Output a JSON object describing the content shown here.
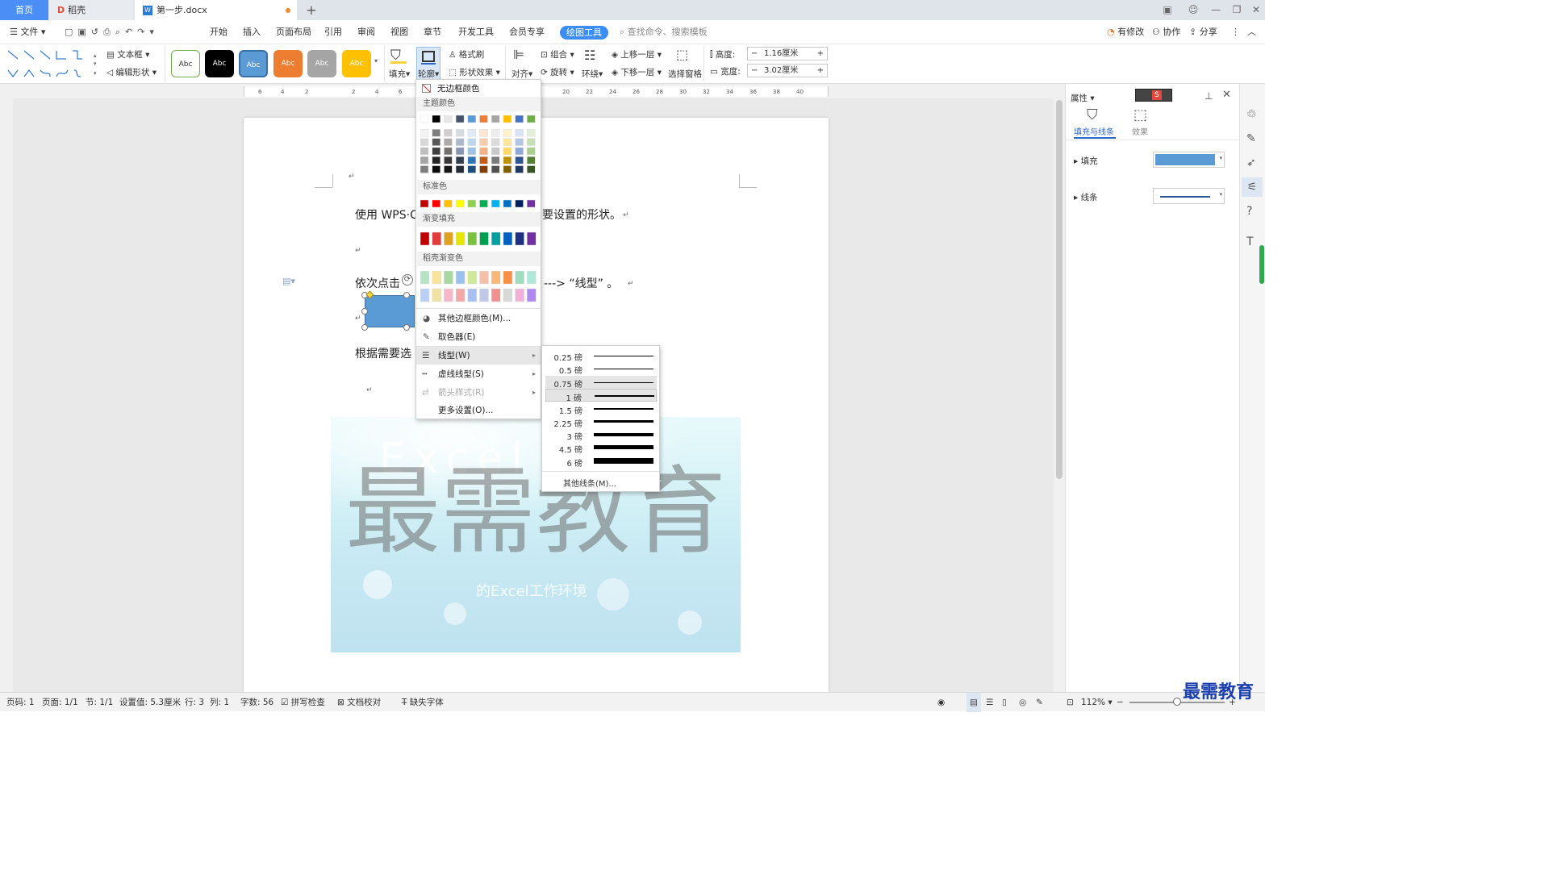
{
  "tabs": {
    "home": "首页",
    "daoke": "稻壳",
    "doc": "第一步.docx"
  },
  "menubar": {
    "file": "文件",
    "items": [
      "开始",
      "插入",
      "页面布局",
      "引用",
      "审阅",
      "视图",
      "章节",
      "开发工具",
      "会员专享"
    ],
    "active": "绘图工具",
    "search": "查找命令、搜索模板",
    "modify": "有修改",
    "collab": "协作",
    "share": "分享"
  },
  "ribbon": {
    "textbox": "文本框",
    "edit_shape": "编辑形状",
    "style_label": "Abc",
    "fill": "填充",
    "outline": "轮廓",
    "format_brush": "格式刷",
    "shape_effect": "形状效果",
    "align": "对齐",
    "group": "组合",
    "rotate": "旋转",
    "wrap": "环绕",
    "up": "上移一层",
    "down": "下移一层",
    "select_pane": "选择窗格",
    "height_label": "高度:",
    "height_value": "1.16厘米",
    "width_label": "宽度:",
    "width_value": "3.02厘米"
  },
  "doc": {
    "line1a": "使用 WPS·C",
    "line1b": "要设置的形状。",
    "line2a": "依次点击",
    "line2b": "--->  “线型”  。",
    "line3": "根据需要选",
    "watermark_big": "最需教育",
    "watermark_sub": "的Excel工作环境",
    "watermark_faint": "Excel"
  },
  "outline_menu": {
    "no_border": "无边框颜色",
    "theme": "主题颜色",
    "standard": "标准色",
    "gradient": "渐变填充",
    "daoke_gradient": "稻壳渐变色",
    "other_color": "其他边框颜色(M)...",
    "picker": "取色器(E)",
    "line_type": "线型(W)",
    "dash_type": "虚线线型(S)",
    "arrow_style": "箭头样式(R)",
    "more": "更多设置(O)..."
  },
  "line_widths": [
    "0.25 磅",
    "0.5 磅",
    "0.75 磅",
    "1 磅",
    "1.5 磅",
    "2.25 磅",
    "3 磅",
    "4.5 磅",
    "6 磅"
  ],
  "line_widths_more": "其他线条(M)...",
  "rpanel": {
    "title": "属性",
    "tab1": "填充与线条",
    "tab2": "效果",
    "fill": "填充",
    "line": "线条",
    "fill_color": "#5b9bd5"
  },
  "status": {
    "pagenum": "页码: 1",
    "page": "页面: 1/1",
    "section": "节: 1/1",
    "setting": "设置值: 5.3厘米",
    "row": "行: 3",
    "col": "列: 1",
    "words": "字数: 56",
    "spell": "拼写检查",
    "proof": "文档校对",
    "font": "缺失字体",
    "zoom": "112%"
  },
  "corner_logo": "最需教育"
}
